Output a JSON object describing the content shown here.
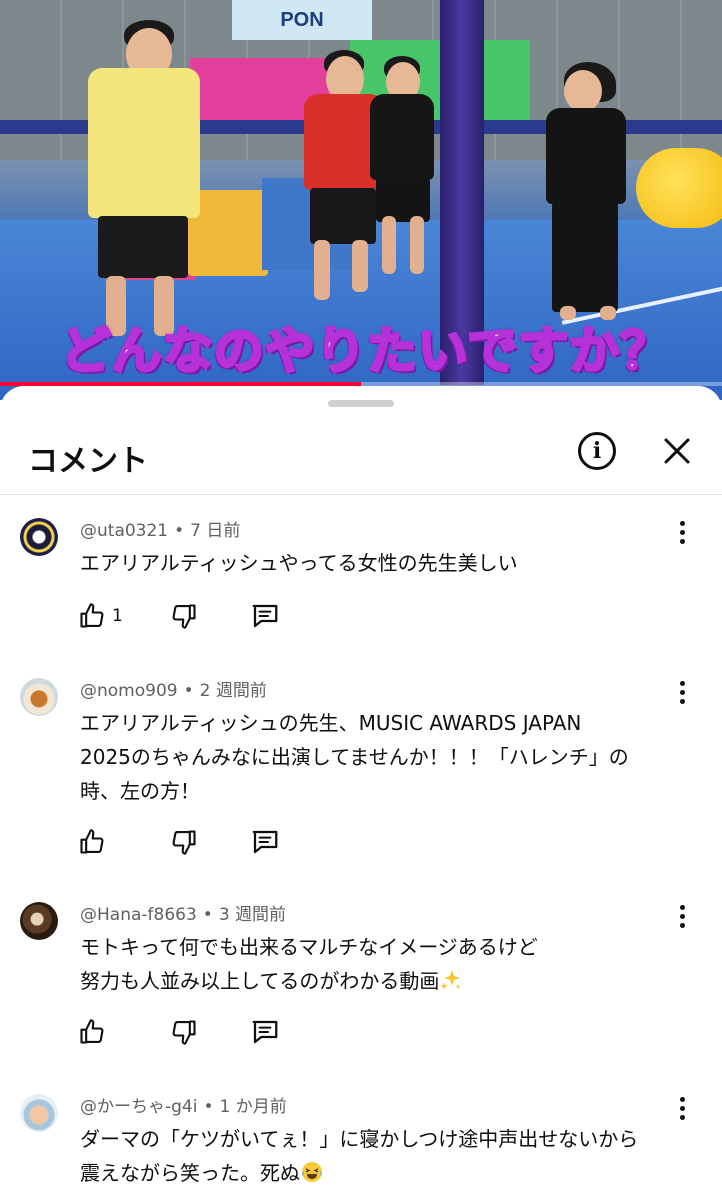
{
  "video": {
    "caption": "どんなのやりたいですか？",
    "sign_text": "PON",
    "progress_fraction": 0.5
  },
  "sheet": {
    "title": "コメント",
    "info_label": "i"
  },
  "comments": [
    {
      "author": "@uta0321",
      "time": "7 日前",
      "lines": [
        "エアリアルティッシュやってる女性の先生美しい"
      ],
      "likes": "1"
    },
    {
      "author": "@nomo909",
      "time": "2 週間前",
      "lines": [
        "エアリアルティッシュの先生、MUSIC AWARDS JAPAN",
        "2025のちゃんみなに出演してませんか！！！「ハレンチ」の",
        "時、左の方！"
      ],
      "likes": ""
    },
    {
      "author": "@Hana-f8663",
      "time": "3 週間前",
      "lines": [
        "モトキって何でも出来るマルチなイメージあるけど",
        "努力も人並み以上してるのがわかる動画"
      ],
      "likes": ""
    },
    {
      "author": "@かーちゃ-g4i",
      "time": "1 か月前",
      "lines": [
        "ダーマの「ケツがいてぇ！」に寝かしつけ途中声出せないから",
        "震えながら笑った。死ぬ"
      ],
      "likes": ""
    }
  ],
  "colors": {
    "caption_outline": "#b632d8",
    "progress": "#ff0033",
    "meta_text": "#606060"
  },
  "icons": [
    "info-icon",
    "close-icon",
    "more-vert-icon",
    "thumb-up-icon",
    "thumb-down-icon",
    "reply-icon",
    "sparkles-emoji",
    "laughing-emoji"
  ]
}
